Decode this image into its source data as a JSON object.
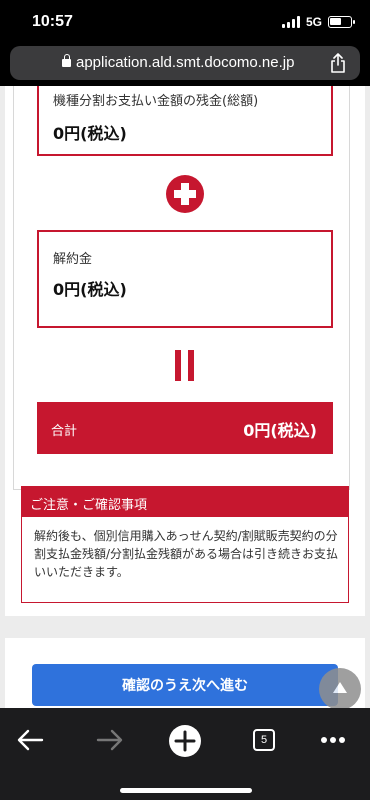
{
  "status_bar": {
    "time": "10:57",
    "network": "5G",
    "battery_level": 0.6
  },
  "browser": {
    "url": "application.ald.smt.docomo.ne.jp",
    "tab_count": "5"
  },
  "summary": {
    "installment_label": "機種分割お支払い金額の残金(総額)",
    "installment_value": "0円(税込)",
    "cancel_fee_label": "解約金",
    "cancel_fee_value": "0円(税込)",
    "total_label": "合計",
    "total_value": "0円(税込)"
  },
  "notice": {
    "title": "ご注意・ご確認事項",
    "body": "解約後も、個別信用購入あっせん契約/割賦販売契約の分割支払金残額/分割払金残額がある場合は引き続きお支払いいただきます。"
  },
  "actions": {
    "next_label": "確認のうえ次へ進む"
  },
  "colors": {
    "accent_red": "#c6172f",
    "button_blue": "#2f72dc"
  },
  "icons": [
    "lock-icon",
    "share-icon",
    "plus-icon",
    "equals-icon",
    "scroll-top-icon",
    "back-icon",
    "forward-icon",
    "new-tab-icon",
    "tabs-icon",
    "more-icon"
  ]
}
